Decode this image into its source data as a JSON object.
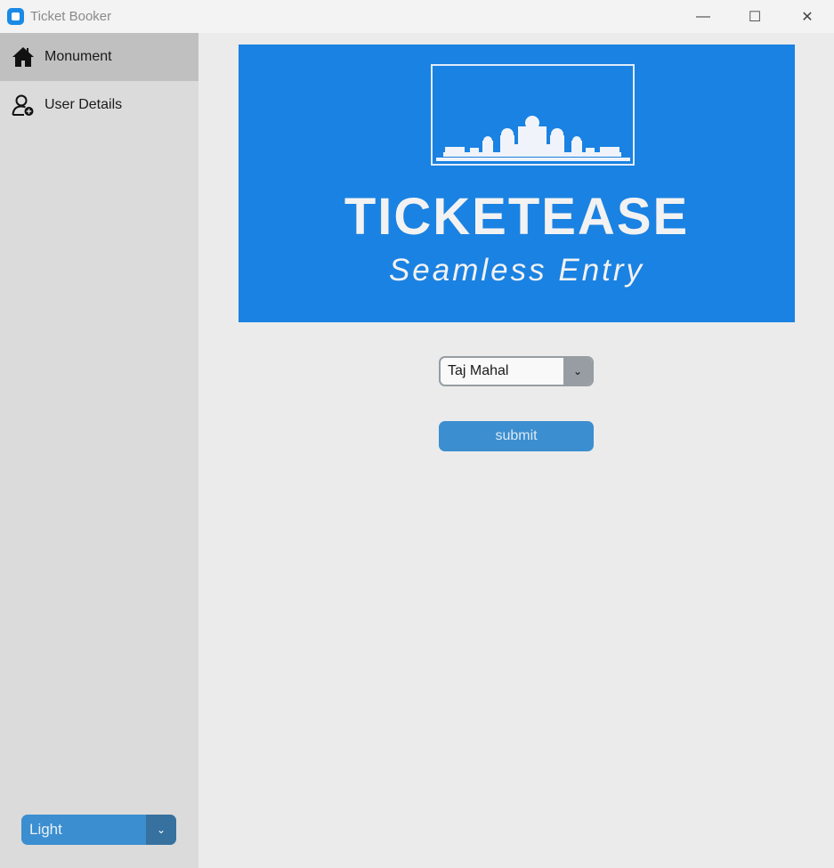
{
  "window": {
    "title": "Ticket Booker",
    "minimize": "—",
    "maximize": "☐",
    "close": "✕"
  },
  "sidebar": {
    "items": [
      {
        "label": "Monument",
        "icon": "home-icon",
        "active": true
      },
      {
        "label": "User Details",
        "icon": "user-add-icon",
        "active": false
      }
    ],
    "appearance": {
      "value": "Light",
      "arrow": "⌄"
    }
  },
  "banner": {
    "title": "TICKETEASE",
    "subtitle": "Seamless Entry",
    "icon": "monument-skyline-icon"
  },
  "form": {
    "monument": {
      "value": "Taj Mahal",
      "arrow": "⌄"
    },
    "submit_label": "submit"
  },
  "colors": {
    "accent": "#3b8ed0",
    "banner": "#1a82e2",
    "sidebar": "#dbdbdb",
    "selected": "#c0c0c0"
  }
}
